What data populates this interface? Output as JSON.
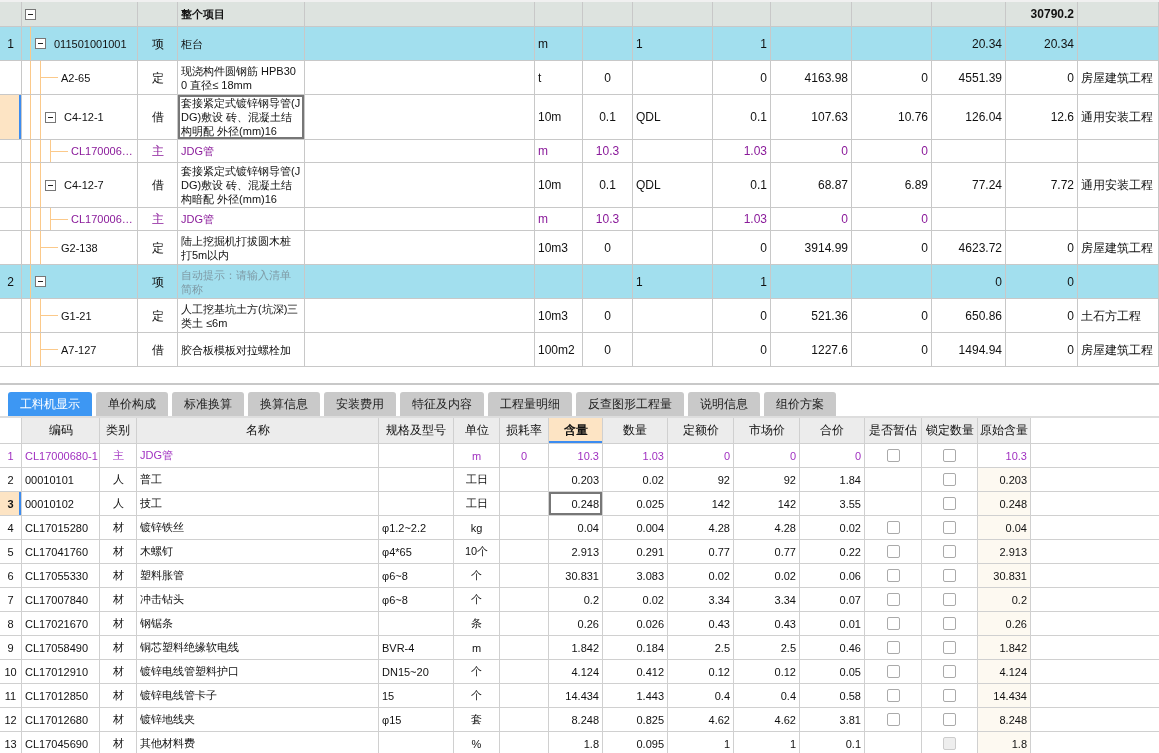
{
  "top_grid": {
    "root": {
      "name": "整个项目",
      "total": "30790.2",
      "expanded": true,
      "children": [
        {
          "no": "1",
          "code": "011501001001",
          "type": "项",
          "kind": "item",
          "name": "柜台",
          "selected": false,
          "expanded": true,
          "cells": [
            "m",
            null,
            "1",
            "1",
            null,
            null,
            "20.34",
            "20.34",
            null
          ],
          "children": [
            {
              "code": "A2-65",
              "type": "定",
              "kind": "quota",
              "name": "现浇构件圆钢筋 HPB300 直径≤ 18mm",
              "selected": false,
              "cells": [
                "t",
                "0",
                null,
                "0",
                "4163.98",
                "0",
                "4551.39",
                "0",
                "房屋建筑工程"
              ]
            },
            {
              "code": "C4-12-1",
              "type": "借",
              "kind": "quota",
              "name": "套接紧定式镀锌钢导管(JDG)敷设 砖、混凝土结构明配 外径(mm)16",
              "selected": true,
              "expanded": true,
              "cells": [
                "10m",
                "0.1",
                "QDL",
                "0.1",
                "107.63",
                "10.76",
                "126.04",
                "12.6",
                "通用安装工程"
              ],
              "children": [
                {
                  "code": "CL170006…",
                  "type": "主",
                  "kind": "main",
                  "name": "JDG管",
                  "selected": false,
                  "cells": [
                    "m",
                    "10.3",
                    null,
                    "1.03",
                    "0",
                    "0",
                    null,
                    null,
                    null
                  ]
                }
              ]
            },
            {
              "code": "C4-12-7",
              "type": "借",
              "kind": "quota",
              "name": "套接紧定式镀锌钢导管(JDG)敷设 砖、混凝土结构暗配 外径(mm)16",
              "selected": false,
              "expanded": true,
              "cells": [
                "10m",
                "0.1",
                "QDL",
                "0.1",
                "68.87",
                "6.89",
                "77.24",
                "7.72",
                "通用安装工程"
              ],
              "children": [
                {
                  "code": "CL170006…",
                  "type": "主",
                  "kind": "main",
                  "name": "JDG管",
                  "selected": false,
                  "cells": [
                    "m",
                    "10.3",
                    null,
                    "1.03",
                    "0",
                    "0",
                    null,
                    null,
                    null
                  ]
                }
              ]
            },
            {
              "code": "G2-138",
              "type": "定",
              "kind": "quota",
              "name": "陆上挖掘机打拔圆木桩打5m以内",
              "selected": false,
              "cells": [
                "10m3",
                "0",
                null,
                "0",
                "3914.99",
                "0",
                "4623.72",
                "0",
                "房屋建筑工程"
              ]
            }
          ]
        },
        {
          "no": "2",
          "type": "项",
          "kind": "item",
          "placeholder": "自动提示：请输入清单简称",
          "selected": false,
          "expanded": true,
          "cells": [
            null,
            null,
            "1",
            "1",
            null,
            null,
            "0",
            "0",
            null
          ],
          "children": [
            {
              "code": "G1-21",
              "type": "定",
              "kind": "quota",
              "name": "人工挖基坑土方(坑深)三类土 ≤6m",
              "selected": false,
              "cells": [
                "10m3",
                "0",
                null,
                "0",
                "521.36",
                "0",
                "650.86",
                "0",
                "土石方工程"
              ]
            },
            {
              "code": "A7-127",
              "type": "借",
              "kind": "quota",
              "name": "胶合板模板对拉螺栓加",
              "selected": false,
              "cells": [
                "100m2",
                "0",
                null,
                "0",
                "1227.6",
                "0",
                "1494.94",
                "0",
                "房屋建筑工程"
              ]
            }
          ]
        }
      ]
    }
  },
  "tabs": [
    {
      "label": "工料机显示",
      "selected": true
    },
    {
      "label": "单价构成",
      "selected": false
    },
    {
      "label": "标准换算",
      "selected": false
    },
    {
      "label": "换算信息",
      "selected": false
    },
    {
      "label": "安装费用",
      "selected": false
    },
    {
      "label": "特征及内容",
      "selected": false
    },
    {
      "label": "工程量明细",
      "selected": false
    },
    {
      "label": "反查图形工程量",
      "selected": false
    },
    {
      "label": "说明信息",
      "selected": false
    },
    {
      "label": "组价方案",
      "selected": false
    }
  ],
  "materials": {
    "columns": [
      {
        "label": "编码",
        "selected": false
      },
      {
        "label": "类别",
        "selected": false
      },
      {
        "label": "名称",
        "selected": false
      },
      {
        "label": "规格及型号",
        "selected": false
      },
      {
        "label": "单位",
        "selected": false
      },
      {
        "label": "损耗率",
        "selected": false
      },
      {
        "label": "含量",
        "selected": true
      },
      {
        "label": "数量",
        "selected": false
      },
      {
        "label": "定额价",
        "selected": false
      },
      {
        "label": "市场价",
        "selected": false
      },
      {
        "label": "合价",
        "selected": false
      },
      {
        "label": "是否暂估",
        "selected": false
      },
      {
        "label": "锁定数量",
        "selected": false
      },
      {
        "label": "原始含量",
        "selected": false
      }
    ],
    "rows": [
      {
        "no": "1",
        "kind": "main",
        "selected": false,
        "code": "CL17000680-1",
        "type": "主",
        "name": "JDG管",
        "unit": "m",
        "loss": "0",
        "amount": "10.3",
        "qty": "1.03",
        "quota_price": "0",
        "market_price": "0",
        "total": "0",
        "estimated": false,
        "locked": false,
        "lock_disabled": false,
        "original": "10.3"
      },
      {
        "no": "2",
        "kind": "normal",
        "selected": false,
        "code": "00010101",
        "type": "人",
        "name": "普工",
        "unit": "工日",
        "amount": "0.203",
        "qty": "0.02",
        "quota_price": "92",
        "market_price": "92",
        "total": "1.84",
        "locked": false,
        "lock_disabled": false,
        "original": "0.203"
      },
      {
        "no": "3",
        "kind": "normal",
        "selected": true,
        "code": "00010102",
        "type": "人",
        "name": "技工",
        "unit": "工日",
        "amount": "0.248",
        "qty": "0.025",
        "quota_price": "142",
        "market_price": "142",
        "total": "3.55",
        "locked": false,
        "lock_disabled": false,
        "original": "0.248"
      },
      {
        "no": "4",
        "kind": "normal",
        "selected": false,
        "code": "CL17015280",
        "type": "材",
        "name": "镀锌铁丝",
        "spec": "φ1.2~2.2",
        "unit": "kg",
        "amount": "0.04",
        "qty": "0.004",
        "quota_price": "4.28",
        "market_price": "4.28",
        "total": "0.02",
        "estimated": false,
        "locked": false,
        "lock_disabled": false,
        "original": "0.04"
      },
      {
        "no": "5",
        "kind": "normal",
        "selected": false,
        "code": "CL17041760",
        "type": "材",
        "name": "木螺钉",
        "spec": "φ4*65",
        "unit": "10个",
        "amount": "2.913",
        "qty": "0.291",
        "quota_price": "0.77",
        "market_price": "0.77",
        "total": "0.22",
        "estimated": false,
        "locked": false,
        "lock_disabled": false,
        "original": "2.913"
      },
      {
        "no": "6",
        "kind": "normal",
        "selected": false,
        "code": "CL17055330",
        "type": "材",
        "name": "塑料胀管",
        "spec": "φ6~8",
        "unit": "个",
        "amount": "30.831",
        "qty": "3.083",
        "quota_price": "0.02",
        "market_price": "0.02",
        "total": "0.06",
        "estimated": false,
        "locked": false,
        "lock_disabled": false,
        "original": "30.831"
      },
      {
        "no": "7",
        "kind": "normal",
        "selected": false,
        "code": "CL17007840",
        "type": "材",
        "name": "冲击钻头",
        "spec": "φ6~8",
        "unit": "个",
        "amount": "0.2",
        "qty": "0.02",
        "quota_price": "3.34",
        "market_price": "3.34",
        "total": "0.07",
        "estimated": false,
        "locked": false,
        "lock_disabled": false,
        "original": "0.2"
      },
      {
        "no": "8",
        "kind": "normal",
        "selected": false,
        "code": "CL17021670",
        "type": "材",
        "name": "钢锯条",
        "unit": "条",
        "amount": "0.26",
        "qty": "0.026",
        "quota_price": "0.43",
        "market_price": "0.43",
        "total": "0.01",
        "estimated": false,
        "locked": false,
        "lock_disabled": false,
        "original": "0.26"
      },
      {
        "no": "9",
        "kind": "normal",
        "selected": false,
        "code": "CL17058490",
        "type": "材",
        "name": "铜芯塑料绝缘软电线",
        "spec": "BVR-4",
        "unit": "m",
        "amount": "1.842",
        "qty": "0.184",
        "quota_price": "2.5",
        "market_price": "2.5",
        "total": "0.46",
        "estimated": false,
        "locked": false,
        "lock_disabled": false,
        "original": "1.842"
      },
      {
        "no": "10",
        "kind": "normal",
        "selected": false,
        "code": "CL17012910",
        "type": "材",
        "name": "镀锌电线管塑料护口",
        "spec": "DN15~20",
        "unit": "个",
        "amount": "4.124",
        "qty": "0.412",
        "quota_price": "0.12",
        "market_price": "0.12",
        "total": "0.05",
        "estimated": false,
        "locked": false,
        "lock_disabled": false,
        "original": "4.124"
      },
      {
        "no": "11",
        "kind": "normal",
        "selected": false,
        "code": "CL17012850",
        "type": "材",
        "name": "镀锌电线管卡子",
        "spec": "15",
        "unit": "个",
        "amount": "14.434",
        "qty": "1.443",
        "quota_price": "0.4",
        "market_price": "0.4",
        "total": "0.58",
        "estimated": false,
        "locked": false,
        "lock_disabled": false,
        "original": "14.434"
      },
      {
        "no": "12",
        "kind": "normal",
        "selected": false,
        "code": "CL17012680",
        "type": "材",
        "name": "镀锌地线夹",
        "spec": "φ15",
        "unit": "套",
        "amount": "8.248",
        "qty": "0.825",
        "quota_price": "4.62",
        "market_price": "4.62",
        "total": "3.81",
        "estimated": false,
        "locked": false,
        "lock_disabled": false,
        "original": "8.248"
      },
      {
        "no": "13",
        "kind": "normal",
        "selected": false,
        "code": "CL17045690",
        "type": "材",
        "name": "其他材料费",
        "unit": "%",
        "amount": "1.8",
        "qty": "0.095",
        "quota_price": "1",
        "market_price": "1",
        "total": "0.1",
        "locked": false,
        "lock_disabled": true,
        "original": "1.8"
      }
    ]
  }
}
